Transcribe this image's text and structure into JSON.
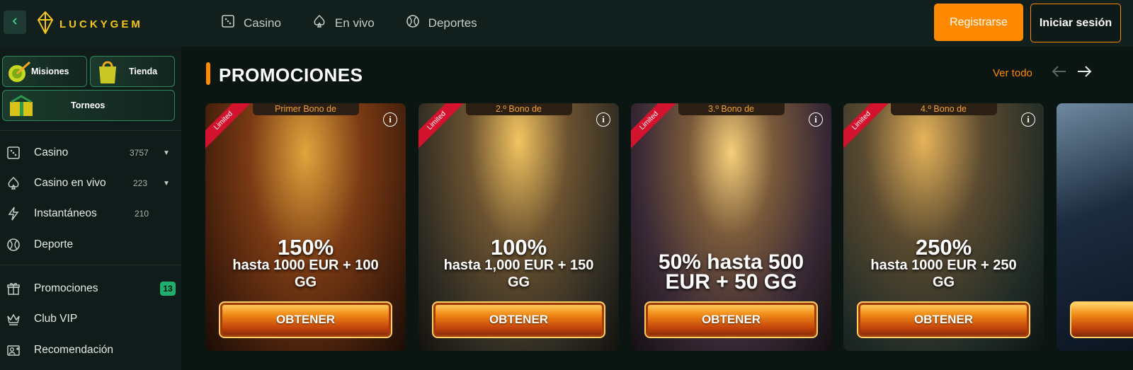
{
  "brand": {
    "name": "LUCKYGEM",
    "accent": "#ff8a00",
    "logo_color": "#f5c518"
  },
  "topnav": [
    {
      "label": "Casino",
      "icon": "dice-icon"
    },
    {
      "label": "En vivo",
      "icon": "spade-icon"
    },
    {
      "label": "Deportes",
      "icon": "ball-icon"
    }
  ],
  "auth": {
    "register_label": "Registrarse",
    "login_label": "Iniciar sesión"
  },
  "sidebar": {
    "quick": [
      {
        "label": "Misiones",
        "icon": "target-icon"
      },
      {
        "label": "Tienda",
        "icon": "shopping-bag-icon"
      },
      {
        "label": "Torneos",
        "icon": "gift-icon"
      }
    ],
    "items": [
      {
        "label": "Casino",
        "count": "3757",
        "icon": "dice-icon",
        "expandable": true
      },
      {
        "label": "Casino en vivo",
        "count": "223",
        "icon": "spade-icon",
        "expandable": true
      },
      {
        "label": "Instantáneos",
        "count": "210",
        "icon": "lightning-icon"
      },
      {
        "label": "Deporte",
        "icon": "ball-icon"
      },
      {
        "label": "Promociones",
        "badge": "13",
        "icon": "gift-icon"
      },
      {
        "label": "Club VIP",
        "icon": "crown-icon"
      },
      {
        "label": "Recomendación",
        "icon": "user-plus-icon"
      }
    ]
  },
  "promotions": {
    "title": "PROMOCIONES",
    "see_all": "Ver todo",
    "cards": [
      {
        "tab": "Primer Bono de",
        "ribbon": "Limited",
        "big": "150%",
        "line1": "hasta 1000 EUR + 100",
        "line2": "GG",
        "cta": "OBTENER",
        "tone": "#5a2d12"
      },
      {
        "tab": "2.º Bono de",
        "ribbon": "Limited",
        "big": "100%",
        "line1": "hasta 1,000 EUR + 150",
        "line2": "GG",
        "cta": "OBTENER",
        "tone": "#3b2f22"
      },
      {
        "tab": "3.º Bono de",
        "ribbon": "Limited",
        "big": "50% hasta 500",
        "line1": "EUR + 50 GG",
        "line2": "",
        "cta": "OBTENER",
        "tone": "#2b1f33"
      },
      {
        "tab": "4.º Bono de",
        "ribbon": "Limited",
        "big": "250%",
        "line1": "hasta 1000 EUR + 250",
        "line2": "GG",
        "cta": "OBTENER",
        "tone": "#1f2e2b"
      }
    ]
  }
}
